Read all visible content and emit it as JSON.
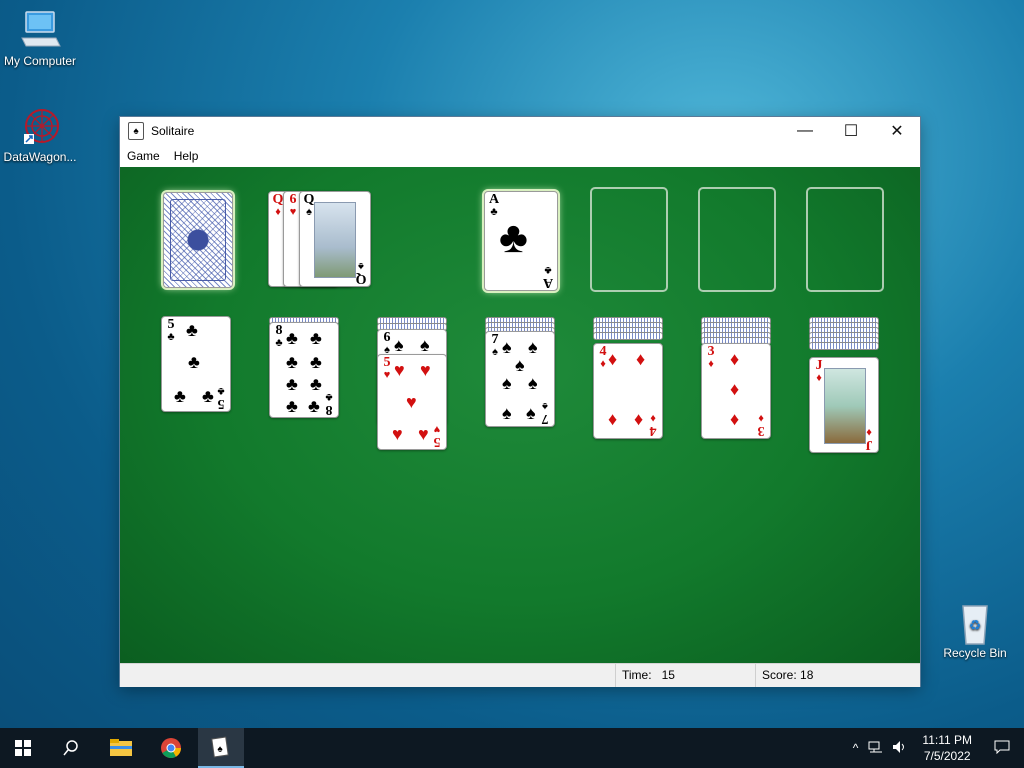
{
  "desktop": {
    "icons": [
      {
        "label": "My Computer"
      },
      {
        "label": "DataWagon..."
      },
      {
        "label": "Recycle Bin"
      }
    ]
  },
  "window": {
    "title": "Solitaire",
    "controls": {
      "minimize": "—",
      "maximize": "☐",
      "close": "✕"
    },
    "menu": [
      "Game",
      "Help"
    ],
    "status": {
      "time_label": "Time:",
      "time_value": "15",
      "score_label": "Score:",
      "score_value": "18"
    }
  },
  "game": {
    "stock": "face-down",
    "waste": [
      "Q♦",
      "6♥",
      "Q♠"
    ],
    "foundations": [
      "A♣",
      "",
      "",
      ""
    ],
    "tableau": [
      {
        "hidden": 0,
        "visible": [
          "5♣"
        ]
      },
      {
        "hidden": 1,
        "visible": [
          "8♣"
        ]
      },
      {
        "hidden": 2,
        "visible": [
          "6♠",
          "5♥"
        ]
      },
      {
        "hidden": 3,
        "visible": [
          "7♠"
        ]
      },
      {
        "hidden": 4,
        "visible": [
          "4♦"
        ]
      },
      {
        "hidden": 5,
        "visible": [
          "3♦"
        ]
      },
      {
        "hidden": 6,
        "visible": [
          "J♦"
        ]
      }
    ],
    "colors": {
      "felt": "#127a2c",
      "red_suit": "#d21010",
      "black_suit": "#000000"
    }
  },
  "taskbar": {
    "clock_time": "11:11 PM",
    "clock_date": "7/5/2022",
    "icons": [
      "windows-start-icon",
      "search-icon",
      "file-explorer-icon",
      "chrome-icon",
      "solitaire-icon"
    ]
  }
}
